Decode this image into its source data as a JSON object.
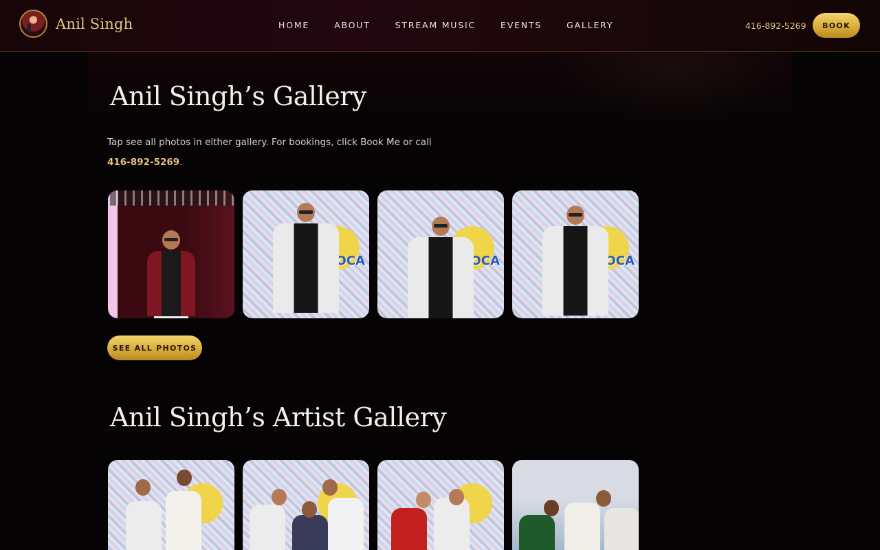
{
  "header": {
    "brand_name": "Anil Singh",
    "nav": [
      "HOME",
      "ABOUT",
      "STREAM MUSIC",
      "EVENTS",
      "GALLERY"
    ],
    "phone": "416-892-5269",
    "book_label": "BOOK"
  },
  "gallery": {
    "title": "Anil Singh’s Gallery",
    "intro_text": "Tap see all photos in either gallery. For bookings, click Book Me or call ",
    "intro_phone": "416-892-5269",
    "intro_end": ".",
    "see_all_label": "SEE ALL PHOTOS",
    "sign_text": "SUMMER SOCA FESTIVAL"
  },
  "artist_gallery": {
    "title": "Anil Singh’s Artist Gallery"
  },
  "colors": {
    "accent_gold": "#e5c57c",
    "button_gold": "#d9ad3a",
    "background": "#050304",
    "header_maroon": "#220710"
  }
}
